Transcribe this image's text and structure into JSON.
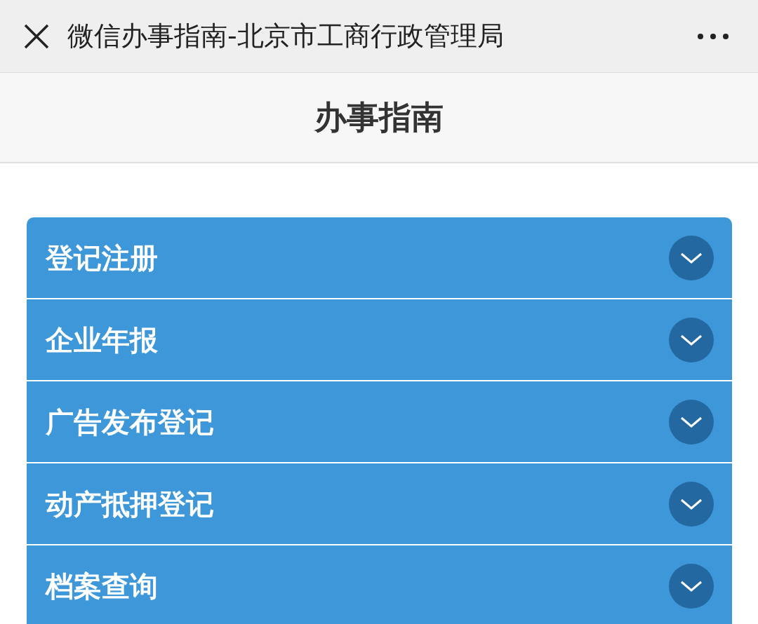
{
  "top_bar": {
    "title": "微信办事指南-北京市工商行政管理局"
  },
  "header": {
    "title": "办事指南"
  },
  "sections": [
    {
      "label": "登记注册",
      "expanded": false
    },
    {
      "label": "企业年报",
      "expanded": false
    },
    {
      "label": "广告发布登记",
      "expanded": false
    },
    {
      "label": "动产抵押登记",
      "expanded": false
    },
    {
      "label": "档案查询",
      "expanded": false
    }
  ]
}
